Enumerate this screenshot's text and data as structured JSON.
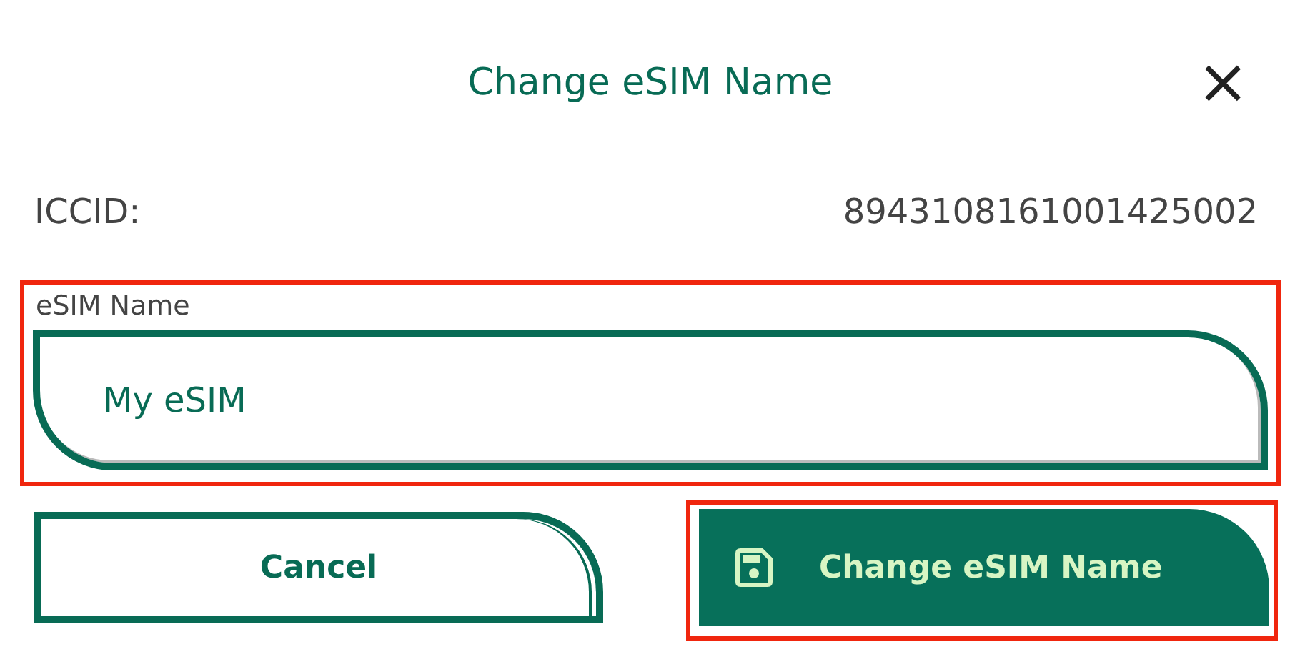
{
  "dialog": {
    "title": "Change eSIM Name",
    "close_label": "×"
  },
  "iccid": {
    "label": "ICCID:",
    "value": "8943108161001425002"
  },
  "name_field": {
    "label": "eSIM Name",
    "value": "My eSIM",
    "highlighted": true
  },
  "buttons": [
    {
      "kind": "secondary",
      "label": "Cancel",
      "highlighted": false
    },
    {
      "kind": "primary",
      "label": "Change eSIM Name",
      "highlighted": true
    }
  ]
}
